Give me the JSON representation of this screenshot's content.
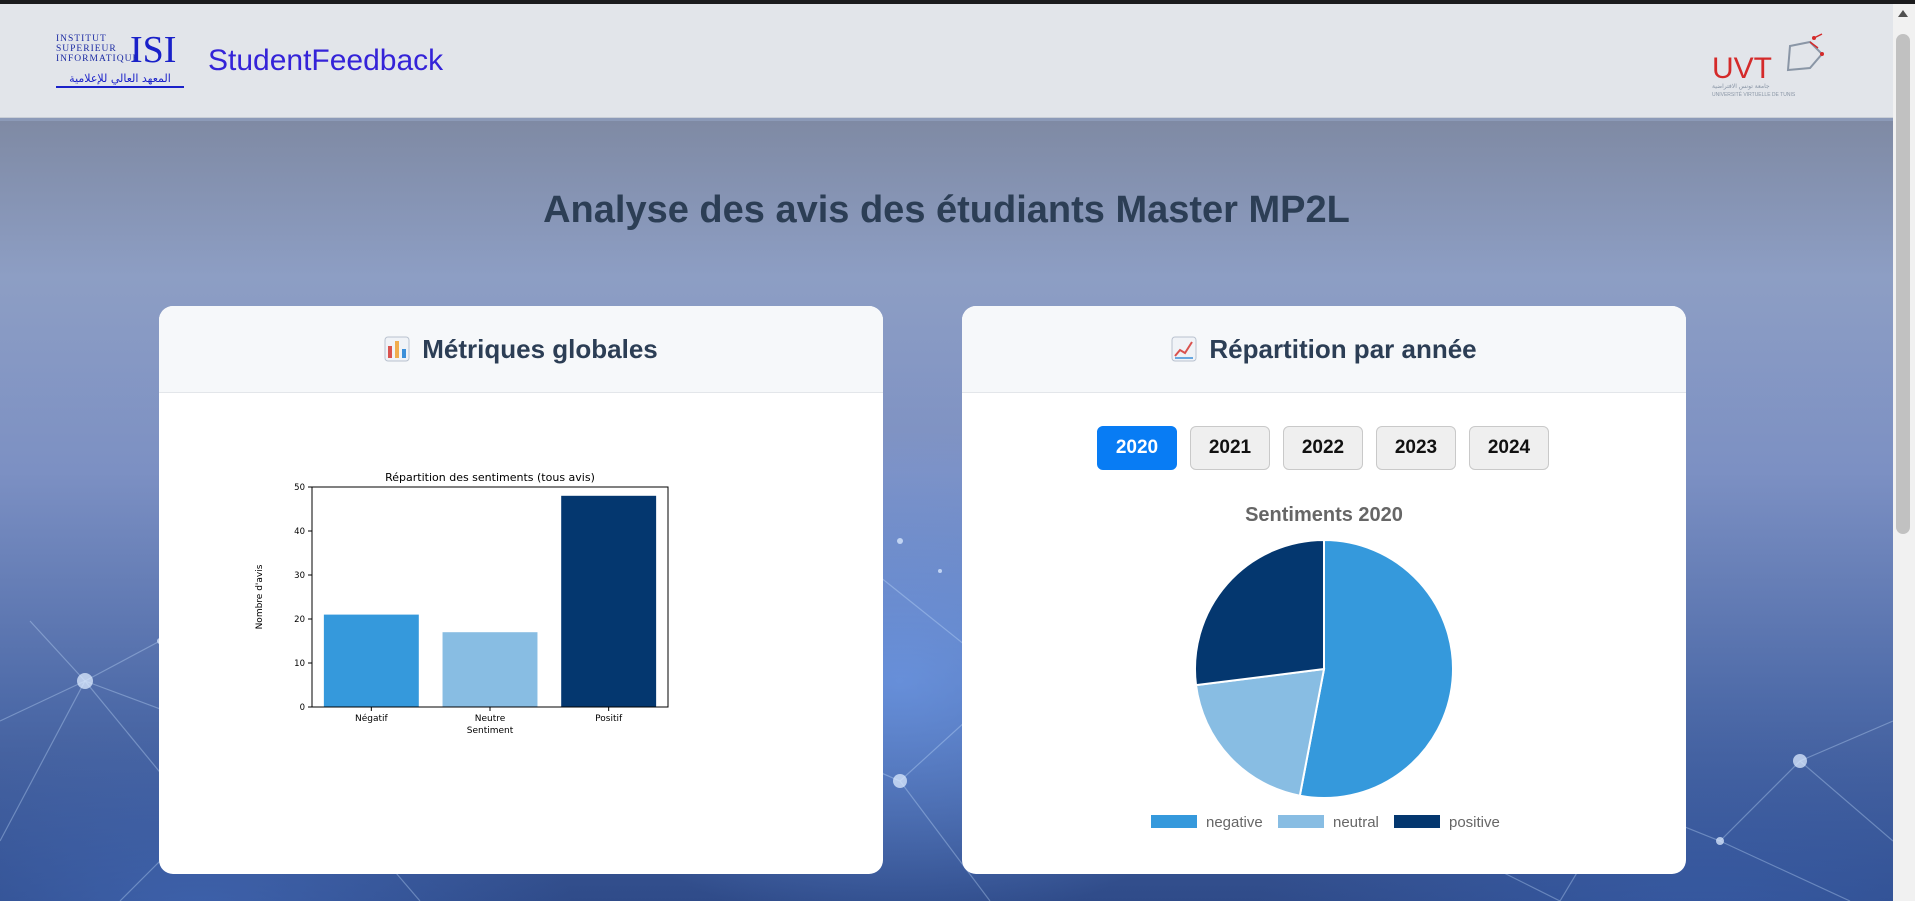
{
  "header": {
    "isi_logo": {
      "lines": [
        "INSTITUT",
        "SUPERIEUR",
        "INFORMATIQUE"
      ],
      "acronym": "ISI",
      "arabic": "المعهد العالي للإعلامية"
    },
    "brand": "StudentFeedback",
    "uvt_logo": {
      "text": "UVT",
      "subtitle": "UNIVERSITÉ VIRTUELLE DE TUNIS",
      "arabic": "جامعة تونس الافتراضية"
    }
  },
  "page_title": "Analyse des avis des étudiants Master MP2L",
  "metrics_card": {
    "title": "Métriques globales",
    "icon": "bar-chart-icon"
  },
  "distribution_card": {
    "title": "Répartition par année",
    "icon": "line-chart-icon",
    "years": [
      "2020",
      "2021",
      "2022",
      "2023",
      "2024"
    ],
    "selected_year": "2020"
  },
  "colors": {
    "negative": "#3599dc",
    "neutral": "#88bde3",
    "positive": "#04376f",
    "active_tab": "#087cf4"
  },
  "chart_data": [
    {
      "type": "bar",
      "title": "Répartition des sentiments (tous avis)",
      "categories": [
        "Négatif",
        "Neutre",
        "Positif"
      ],
      "values": [
        21,
        17,
        48
      ],
      "xlabel": "Sentiment",
      "ylabel": "Nombre d'avis",
      "ylim": [
        0,
        50
      ],
      "yticks": [
        0,
        10,
        20,
        30,
        40,
        50
      ],
      "colors": [
        "#3599dc",
        "#88bde3",
        "#04376f"
      ]
    },
    {
      "type": "pie",
      "title": "Sentiments 2020",
      "labels": [
        "negative",
        "neutral",
        "positive"
      ],
      "values": [
        53,
        20,
        27
      ],
      "colors": [
        "#3599dc",
        "#88bde3",
        "#04376f"
      ],
      "legend": "bottom"
    }
  ]
}
